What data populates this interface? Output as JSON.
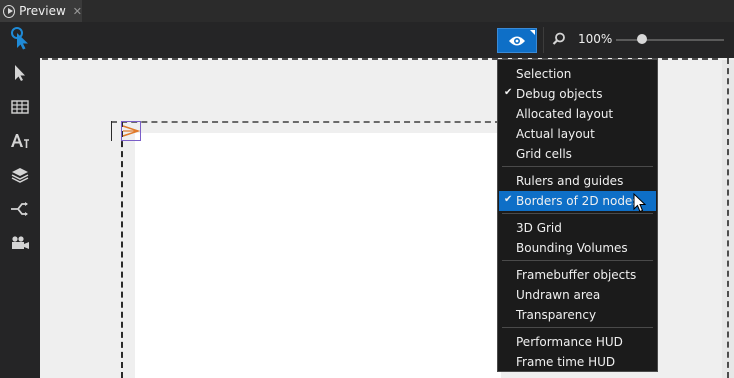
{
  "tab": {
    "title": "Preview",
    "close": "✕"
  },
  "toolbar": {
    "zoom_label": "100%",
    "zoom_level_percent": 100,
    "zoom_slider_fraction": 0.24
  },
  "menu": {
    "groups": [
      [
        {
          "label": "Selection",
          "checked": false
        },
        {
          "label": "Debug objects",
          "checked": true
        },
        {
          "label": "Allocated layout",
          "checked": false
        },
        {
          "label": "Actual layout",
          "checked": false
        },
        {
          "label": "Grid cells",
          "checked": false
        }
      ],
      [
        {
          "label": "Rulers and guides",
          "checked": false
        },
        {
          "label": "Borders of 2D nodes",
          "checked": true,
          "highlighted": true
        }
      ],
      [
        {
          "label": "3D Grid",
          "checked": false
        },
        {
          "label": "Bounding Volumes",
          "checked": false
        }
      ],
      [
        {
          "label": "Framebuffer objects",
          "checked": false
        },
        {
          "label": "Undrawn area",
          "checked": false
        },
        {
          "label": "Transparency",
          "checked": false
        }
      ],
      [
        {
          "label": "Performance HUD",
          "checked": false
        },
        {
          "label": "Frame time HUD",
          "checked": false
        }
      ]
    ]
  },
  "colors": {
    "accent": "#0e6fc7",
    "menu_bg": "#1b1b1b",
    "panel_bg": "#252526",
    "canvas_bg": "#efefef"
  },
  "icons": {
    "left_tools": [
      "pointer-pick-icon",
      "arrow-select-icon",
      "grid-icon",
      "text-size-icon",
      "layers-icon",
      "connections-icon",
      "camera-icon"
    ],
    "toolbar": [
      "eye-icon",
      "magnifier-icon"
    ]
  }
}
